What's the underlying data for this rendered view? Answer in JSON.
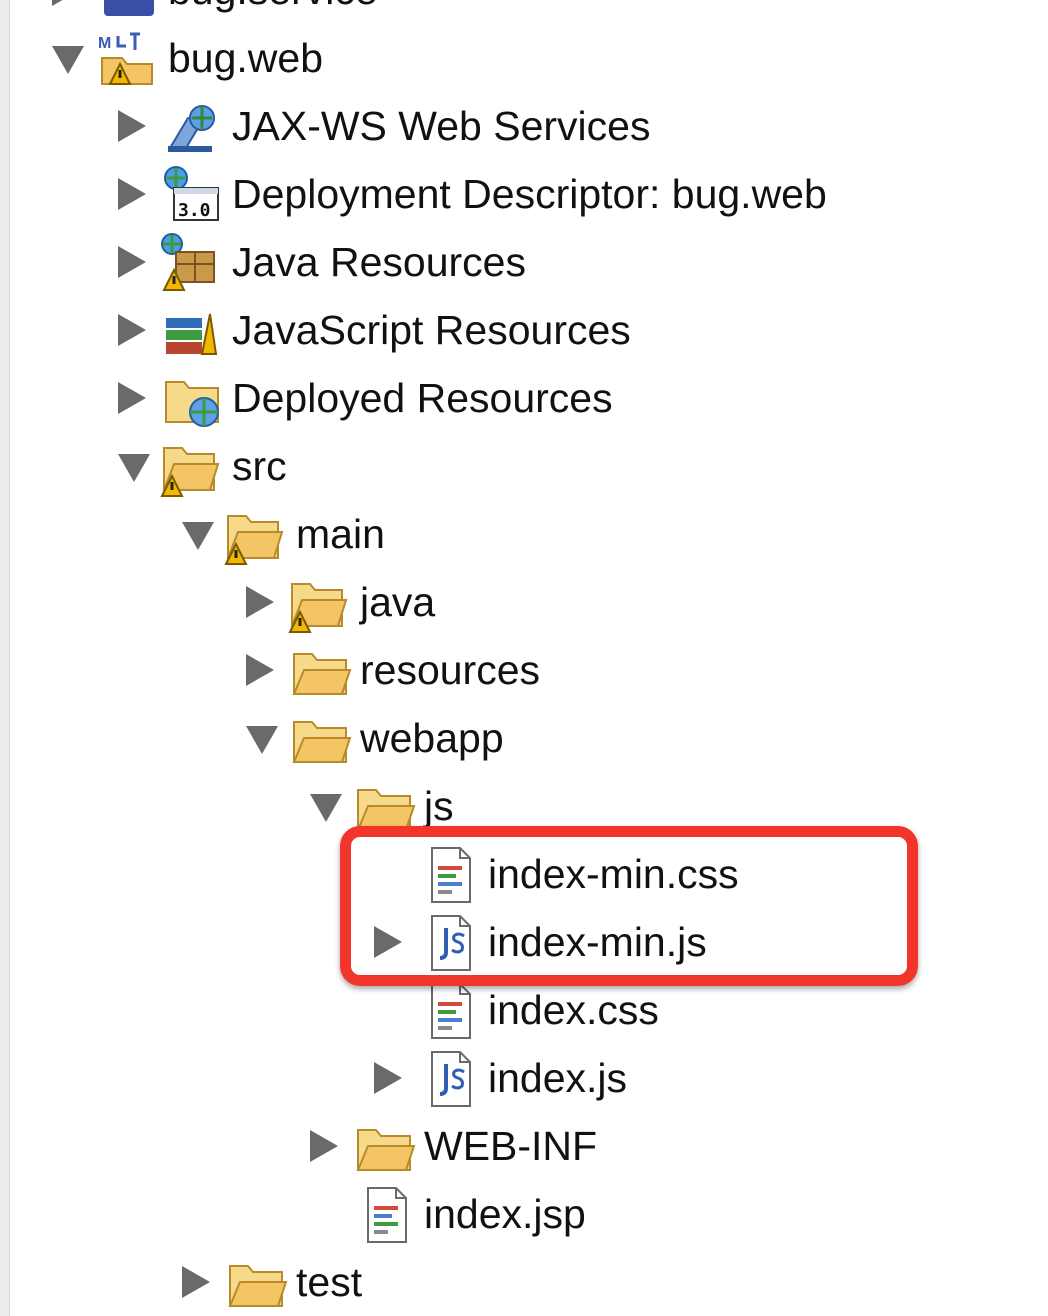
{
  "window": {
    "title": ""
  },
  "tree": {
    "partial_top_label": "bug.service",
    "rows": [
      {
        "label": "bug.web",
        "icon": "maven-web-project-warning-icon",
        "expanded": true
      },
      {
        "label": "JAX-WS Web Services",
        "icon": "jaxws-services-icon",
        "expanded": false
      },
      {
        "label": "Deployment Descriptor: bug.web",
        "icon": "deployment-descriptor-icon",
        "badge": "3.0",
        "expanded": false
      },
      {
        "label": "Java Resources",
        "icon": "java-resources-warning-icon",
        "expanded": false
      },
      {
        "label": "JavaScript Resources",
        "icon": "javascript-resources-icon",
        "expanded": false
      },
      {
        "label": "Deployed Resources",
        "icon": "deployed-resources-icon",
        "expanded": false
      },
      {
        "label": "src",
        "icon": "folder-warning-icon",
        "expanded": true
      },
      {
        "label": "main",
        "icon": "folder-warning-icon",
        "expanded": true
      },
      {
        "label": "java",
        "icon": "folder-warning-icon",
        "expanded": false
      },
      {
        "label": "resources",
        "icon": "folder-icon",
        "expanded": false
      },
      {
        "label": "webapp",
        "icon": "folder-icon",
        "expanded": true
      },
      {
        "label": "js",
        "icon": "folder-icon",
        "expanded": true
      },
      {
        "label": "index-min.css",
        "icon": "css-file-icon"
      },
      {
        "label": "index-min.js",
        "icon": "js-file-icon",
        "expanded": false
      },
      {
        "label": "index.css",
        "icon": "css-file-icon"
      },
      {
        "label": "index.js",
        "icon": "js-file-icon",
        "expanded": false
      },
      {
        "label": "WEB-INF",
        "icon": "folder-icon",
        "expanded": false
      },
      {
        "label": "index.jsp",
        "icon": "jsp-file-icon"
      },
      {
        "label": "test",
        "icon": "folder-icon",
        "expanded": false
      }
    ]
  },
  "colors": {
    "highlight": "#f2352a",
    "folder": "#f3c565",
    "warning": "#f2b800",
    "twisty": "#6a6a6a"
  }
}
